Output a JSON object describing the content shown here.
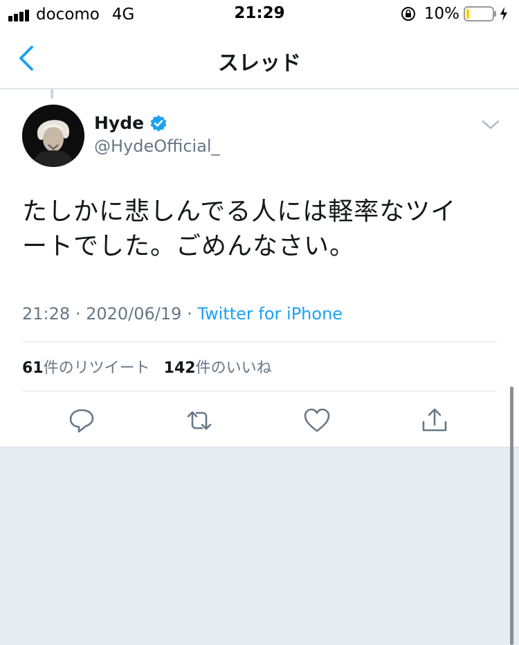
{
  "status_bar": {
    "carrier": "docomo",
    "network": "4G",
    "time": "21:29",
    "battery": "10%",
    "icons": [
      "signal-icon",
      "orientation-lock-icon",
      "battery-icon",
      "charging-bolt-icon"
    ],
    "battery_fill_fraction": 0.1,
    "battery_fill_color": "#ffcc00"
  },
  "nav": {
    "title": "スレッド",
    "back_icon": "chevron-left-icon",
    "accent": "#1da1f2"
  },
  "tweet": {
    "display_name": "Hyde",
    "handle": "@HydeOfficial_",
    "verified": true,
    "text_line1": "たしかに悲しんでる人には軽率なツイ",
    "text_line2": "ートでした。ごめんなさい。",
    "time": "21:28",
    "date": "2020/06/19",
    "separator": "·",
    "source": "Twitter for iPhone",
    "retweets_count": "61",
    "retweets_label": "件のリツイート",
    "likes_count": "142",
    "likes_label": "件のいいね",
    "actions": [
      "reply-icon",
      "retweet-icon",
      "like-icon",
      "share-icon"
    ]
  }
}
